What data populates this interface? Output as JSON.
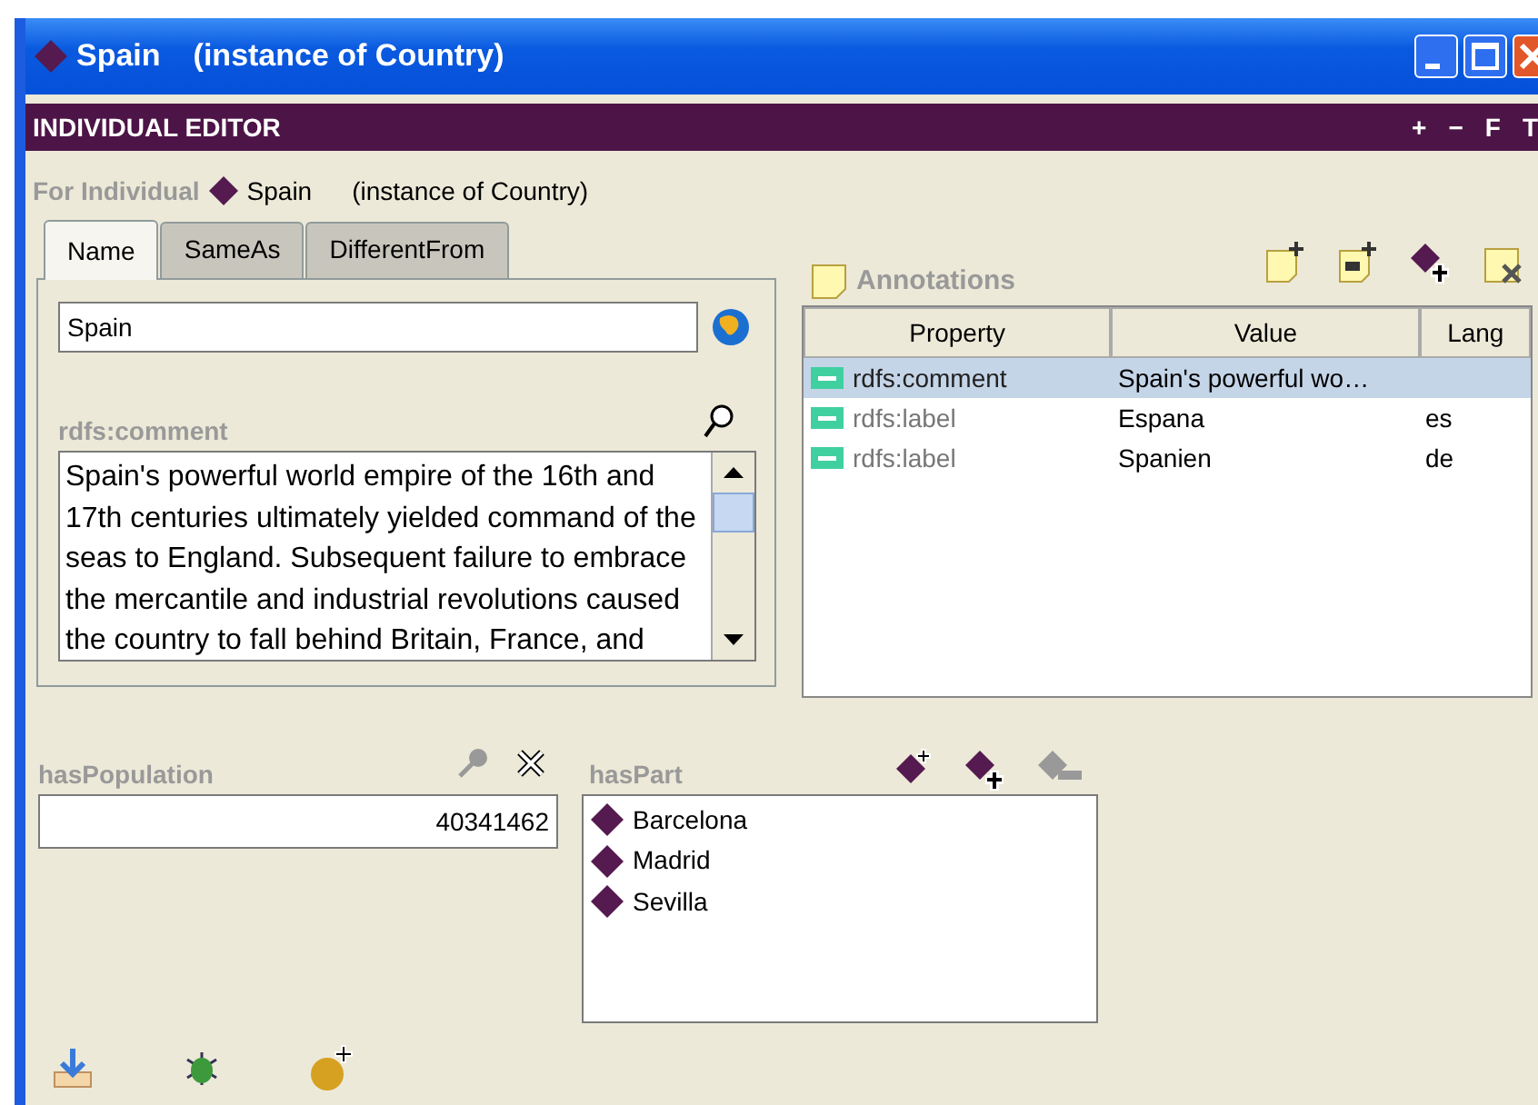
{
  "window": {
    "title": "Spain",
    "subtitle": "(instance of Country)"
  },
  "editor_bar": {
    "title": "INDIVIDUAL EDITOR",
    "buttons": [
      "+",
      "−",
      "F",
      "T"
    ]
  },
  "for_individual": {
    "label": "For Individual",
    "name": "Spain",
    "type": "(instance of Country)"
  },
  "tabs": [
    {
      "label": "Name",
      "selected": true
    },
    {
      "label": "SameAs",
      "selected": false
    },
    {
      "label": "DifferentFrom",
      "selected": false
    }
  ],
  "name_field": {
    "value": "Spain"
  },
  "comment": {
    "label": "rdfs:comment",
    "value": "Spain's powerful world empire of the 16th and 17th centuries ultimately yielded command of the seas to England. Subsequent failure to embrace the mercantile and industrial revolutions caused the country to fall behind Britain, France, and"
  },
  "annotations": {
    "title": "Annotations",
    "columns": [
      "Property",
      "Value",
      "Lang"
    ],
    "rows": [
      {
        "property": "rdfs:comment",
        "value": "Spain's powerful wo…",
        "selected": true
      },
      {
        "property": "rdfs:label",
        "value": "Espana",
        "lang": "es",
        "selected": false
      },
      {
        "property": "rdfs:label",
        "value": "Spanien",
        "lang": "de",
        "selected": false
      }
    ]
  },
  "population": {
    "label": "hasPopulation",
    "value": "40341462"
  },
  "has_part": {
    "label": "hasPart",
    "items": [
      "Barcelona",
      "Madrid",
      "Sevilla"
    ]
  }
}
